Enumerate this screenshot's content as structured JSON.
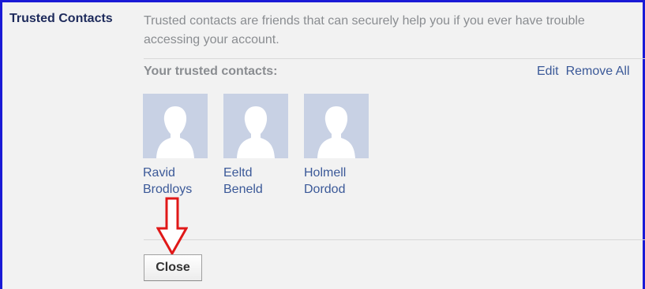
{
  "section": {
    "title": "Trusted Contacts",
    "description": "Trusted contacts are friends that can securely help you if you ever have trouble accessing your account."
  },
  "contacts_panel": {
    "heading": "Your trusted contacts:",
    "edit_label": "Edit",
    "remove_all_label": "Remove All"
  },
  "contacts": [
    {
      "first": "Ravid",
      "last": "Brodloys"
    },
    {
      "first": "Eeltd",
      "last": "Beneld"
    },
    {
      "first": "Holmell",
      "last": "Dordod"
    }
  ],
  "close_button_label": "Close",
  "colors": {
    "frame_border": "#1a1ad6",
    "link": "#3b5998",
    "annotation_arrow": "#e01818",
    "avatar_bg": "#c8d1e4"
  },
  "icons": {
    "avatar": "default-profile-silhouette-icon",
    "annotation": "down-arrow-icon"
  }
}
